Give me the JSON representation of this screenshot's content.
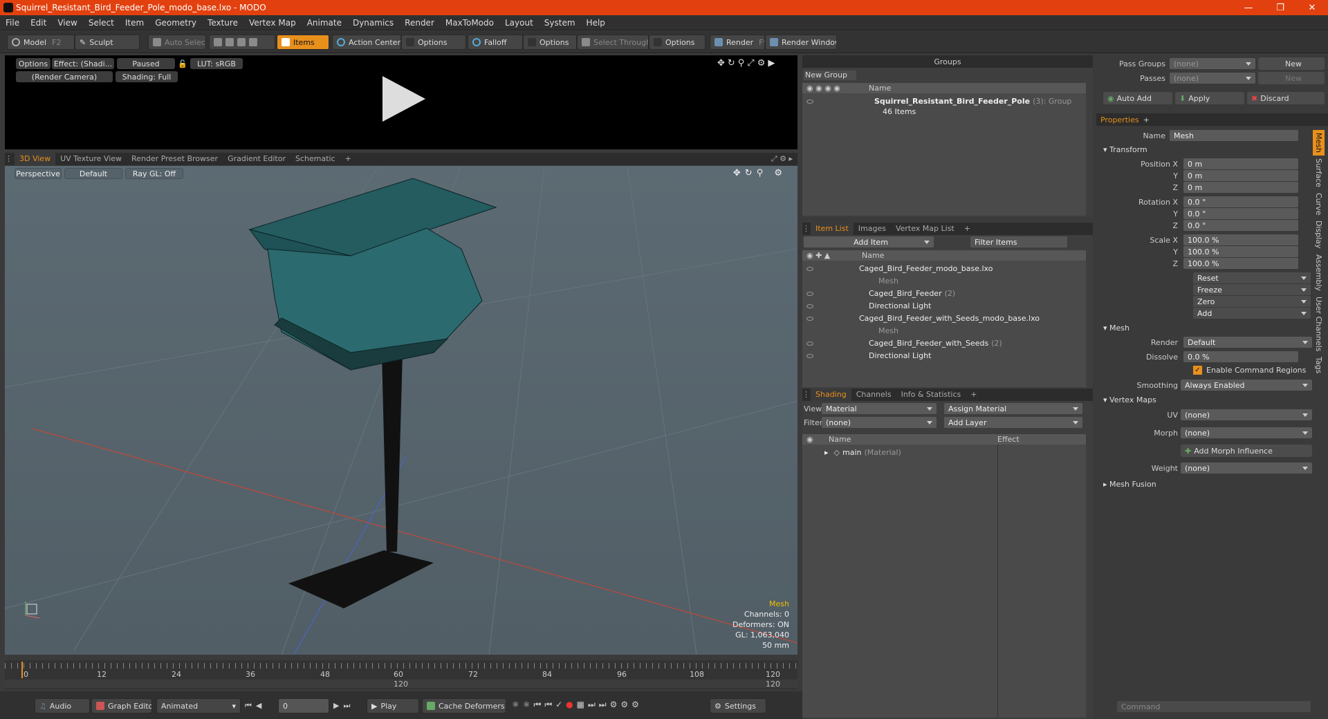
{
  "window": {
    "title": "Squirrel_Resistant_Bird_Feeder_Pole_modo_base.lxo - MODO"
  },
  "menu": [
    "File",
    "Edit",
    "View",
    "Select",
    "Item",
    "Geometry",
    "Texture",
    "Vertex Map",
    "Animate",
    "Dynamics",
    "Render",
    "MaxToModo",
    "Layout",
    "System",
    "Help"
  ],
  "toolbar": {
    "model": "Model",
    "model_key": "F2",
    "sculpt": "Sculpt",
    "auto_select": "Auto Select",
    "items": "Items",
    "action_center": "Action Center",
    "options": "Options",
    "falloff": "Falloff",
    "select_through": "Select Through",
    "render": "Render",
    "render_key": "F9",
    "render_window": "Render Window"
  },
  "preview": {
    "options": "Options",
    "effect": "Effect: (Shadi...",
    "paused": "Paused",
    "lut": "LUT: sRGB",
    "camera": "(Render Camera)",
    "shading": "Shading: Full"
  },
  "viewport_tabs": [
    "3D View",
    "UV Texture View",
    "Render Preset Browser",
    "Gradient Editor",
    "Schematic",
    "+"
  ],
  "viewport": {
    "perspective": "Perspective",
    "default": "Default",
    "raygl": "Ray GL: Off",
    "hud": {
      "mesh": "Mesh",
      "channels": "Channels: 0",
      "deformers": "Deformers: ON",
      "gl": "GL: 1,063,040",
      "mm": "50 mm"
    }
  },
  "timeline": {
    "ticks": [
      "0",
      "12",
      "24",
      "36",
      "48",
      "60",
      "72",
      "84",
      "96",
      "108",
      "120"
    ],
    "bottom_mid": "120",
    "bottom_end": "120"
  },
  "bottombar": {
    "audio": "Audio",
    "graph": "Graph Editor",
    "animated": "Animated",
    "frame": "0",
    "play": "Play",
    "cache": "Cache Deformers",
    "settings": "Settings"
  },
  "groups": {
    "title": "Groups",
    "new_group": "New Group",
    "col_name": "Name",
    "group_name": "Squirrel_Resistant_Bird_Feeder_Pole",
    "group_count": "(3)",
    "group_type": ": Group",
    "group_items": "46 Items"
  },
  "itemlist": {
    "tabs": [
      "Item List",
      "Images",
      "Vertex Map List",
      "+"
    ],
    "add_item": "Add Item",
    "filter": "Filter Items",
    "col_name": "Name",
    "rows": [
      {
        "label": "Caged_Bird_Feeder_modo_base.lxo",
        "extra": "",
        "indent": 0,
        "gray": false
      },
      {
        "label": "Mesh",
        "extra": "",
        "indent": 2,
        "gray": true
      },
      {
        "label": "Caged_Bird_Feeder",
        "extra": "(2)",
        "indent": 1,
        "gray": false
      },
      {
        "label": "Directional Light",
        "extra": "",
        "indent": 1,
        "gray": false
      },
      {
        "label": "Caged_Bird_Feeder_with_Seeds_modo_base.lxo",
        "extra": "",
        "indent": 0,
        "gray": false
      },
      {
        "label": "Mesh",
        "extra": "",
        "indent": 2,
        "gray": true
      },
      {
        "label": "Caged_Bird_Feeder_with_Seeds",
        "extra": "(2)",
        "indent": 1,
        "gray": false
      },
      {
        "label": "Directional Light",
        "extra": "",
        "indent": 1,
        "gray": false
      }
    ]
  },
  "shading": {
    "tabs": [
      "Shading",
      "Channels",
      "Info & Statistics",
      "+"
    ],
    "view_label": "View",
    "view_value": "Material",
    "assign": "Assign Material",
    "filter_label": "Filter",
    "filter_value": "(none)",
    "add_layer": "Add Layer",
    "col_name": "Name",
    "col_effect": "Effect",
    "row_name": "main",
    "row_type": "(Material)"
  },
  "passes": {
    "pass_groups": "Pass Groups",
    "passes": "Passes",
    "none": "(none)",
    "new": "New",
    "auto_add": "Auto Add",
    "apply": "Apply",
    "discard": "Discard"
  },
  "properties": {
    "tab": "Properties",
    "name_label": "Name",
    "name_value": "Mesh",
    "transform": "Transform",
    "position_label": "Position X",
    "rotation_label": "Rotation X",
    "scale_label": "Scale X",
    "y": "Y",
    "z": "Z",
    "pos": [
      "0 m",
      "0 m",
      "0 m"
    ],
    "rot": [
      "0.0 °",
      "0.0 °",
      "0.0 °"
    ],
    "scale": [
      "100.0 %",
      "100.0 %",
      "100.0 %"
    ],
    "reset": "Reset",
    "freeze": "Freeze",
    "zero": "Zero",
    "add": "Add",
    "mesh": "Mesh",
    "render_label": "Render",
    "render_value": "Default",
    "dissolve_label": "Dissolve",
    "dissolve_value": "0.0 %",
    "cmd_regions": "Enable Command Regions",
    "smoothing_label": "Smoothing",
    "smoothing_value": "Always Enabled",
    "vertex_maps": "Vertex Maps",
    "uv_label": "UV",
    "morph_label": "Morph",
    "weight_label": "Weight",
    "none": "(none)",
    "add_morph": "Add Morph Influence",
    "mesh_fusion": "Mesh Fusion",
    "vtabs": [
      "Mesh",
      "Surface",
      "Curve",
      "Display",
      "Assembly",
      "User Channels",
      "Tags"
    ]
  },
  "command": {
    "placeholder": "Command"
  }
}
